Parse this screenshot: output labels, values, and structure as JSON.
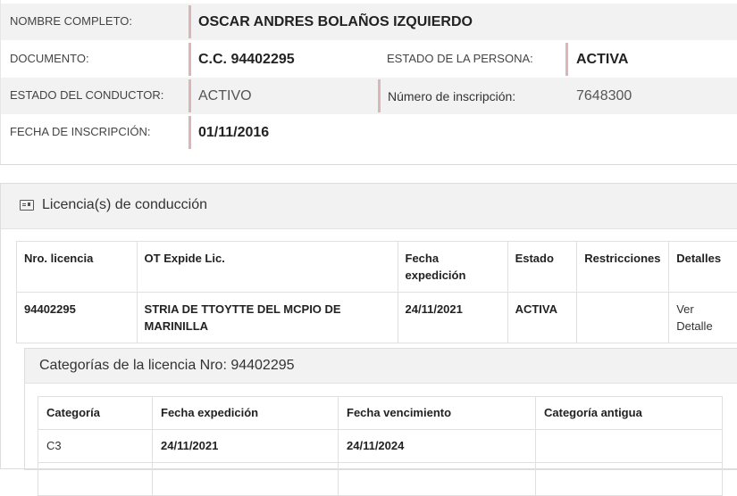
{
  "person": {
    "nombre_label": "NOMBRE COMPLETO:",
    "nombre_value": "OSCAR ANDRES BOLAÑOS IZQUIERDO",
    "documento_label": "DOCUMENTO:",
    "documento_value": "C.C. 94402295",
    "estado_persona_label": "ESTADO DE LA PERSONA:",
    "estado_persona_value": "ACTIVA",
    "estado_conductor_label": "ESTADO DEL CONDUCTOR:",
    "estado_conductor_value": "ACTIVO",
    "num_inscripcion_label": "Número de inscripción:",
    "num_inscripcion_value": "7648300",
    "fecha_inscripcion_label": "FECHA DE INSCRIPCIÓN:",
    "fecha_inscripcion_value": "01/11/2016"
  },
  "licencias": {
    "title": "Licencia(s) de conducción",
    "headers": [
      "Nro. licencia",
      "OT Expide Lic.",
      "Fecha expedición",
      "Estado",
      "Restricciones",
      "Detalles"
    ],
    "rows": [
      {
        "nro": "94402295",
        "ot": "STRIA DE TTOYTTE DEL MCPIO DE MARINILLA",
        "fecha": "24/11/2021",
        "estado": "ACTIVA",
        "restricciones": "",
        "detalles": "Ver Detalle"
      }
    ]
  },
  "categorias": {
    "title": "Categorías de la licencia Nro: 94402295",
    "headers": [
      "Categoría",
      "Fecha expedición",
      "Fecha vencimiento",
      "Categoría antigua"
    ],
    "rows": [
      {
        "categoria": "C3",
        "expedicion": "24/11/2021",
        "vencimiento": "24/11/2024",
        "antigua": ""
      }
    ]
  }
}
